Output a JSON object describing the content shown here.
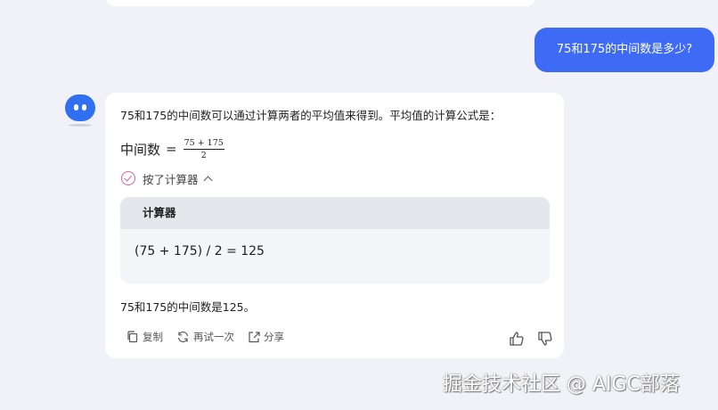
{
  "user_message": "75和175的中间数是多少?",
  "assistant": {
    "intro": "75和175的中间数可以通过计算两者的平均值来得到。平均值的计算公式是：",
    "formula": {
      "lhs": "中间数",
      "eq": "=",
      "numerator": "75 + 175",
      "denominator": "2"
    },
    "tool_toggle_label": "按了计算器",
    "calculator": {
      "title": "计算器",
      "expression": "(75 + 175) / 2 = 125"
    },
    "result": "75和175的中间数是125。",
    "actions": {
      "copy": "复制",
      "retry": "再试一次",
      "share": "分享"
    }
  },
  "watermark": "掘金技术社区 @ AIGC部落",
  "colors": {
    "background": "#f1f2f7",
    "user_bubble": "#3d6bf5",
    "avatar": "#2f6ff0",
    "tool_check": "#e0609a"
  },
  "icons": [
    "check-circle-icon",
    "chevron-up-icon",
    "copy-icon",
    "refresh-icon",
    "share-icon",
    "thumbs-up-icon",
    "thumbs-down-icon"
  ]
}
